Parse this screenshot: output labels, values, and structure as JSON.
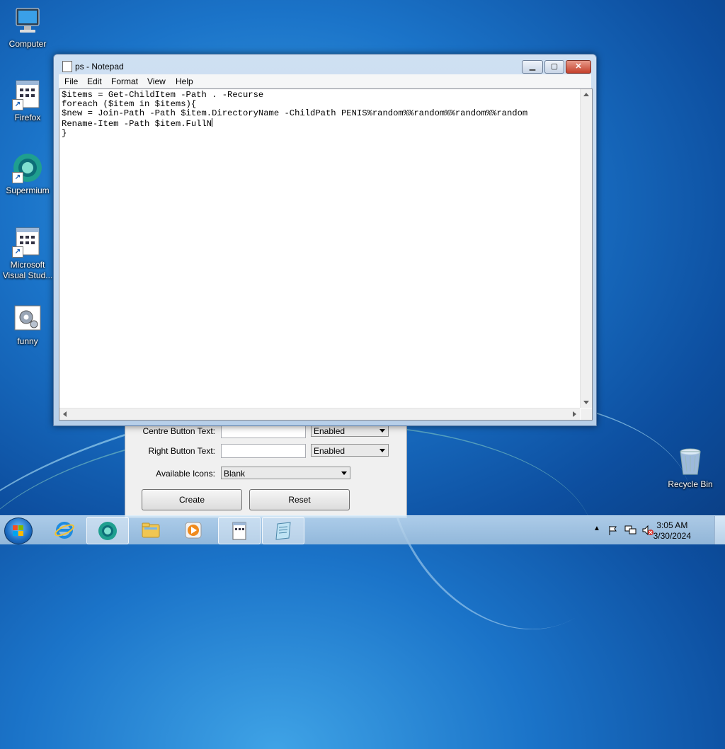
{
  "desktop": {
    "icons": [
      {
        "label": "Computer"
      },
      {
        "label": "Firefox"
      },
      {
        "label": "Supermium"
      },
      {
        "label": "Microsoft Visual Stud..."
      },
      {
        "label": "funny"
      },
      {
        "label": "Recycle Bin"
      }
    ]
  },
  "background_dialog": {
    "centre_label": "Centre Button Text:",
    "centre_state": "Enabled",
    "right_label": "Right Button Text:",
    "right_state": "Enabled",
    "icons_label": "Available Icons:",
    "icons_value": "Blank",
    "create_label": "Create",
    "reset_label": "Reset"
  },
  "notepad": {
    "title": "ps - Notepad",
    "menu": [
      "File",
      "Edit",
      "Format",
      "View",
      "Help"
    ],
    "lines": [
      "$items = Get-ChildItem -Path . -Recurse",
      "foreach ($item in $items){",
      "$new = Join-Path -Path $item.DirectoryName -ChildPath PENIS%random%%random%%random%%random",
      "Rename-Item -Path $item.FullN",
      "}"
    ]
  },
  "taskbar": {
    "time": "3:05 AM",
    "date": "3/30/2024"
  },
  "colors": {
    "desktop_bg": "#1b74c9",
    "close_button": "#c4402b",
    "window_frame": "#b7cfe9"
  }
}
